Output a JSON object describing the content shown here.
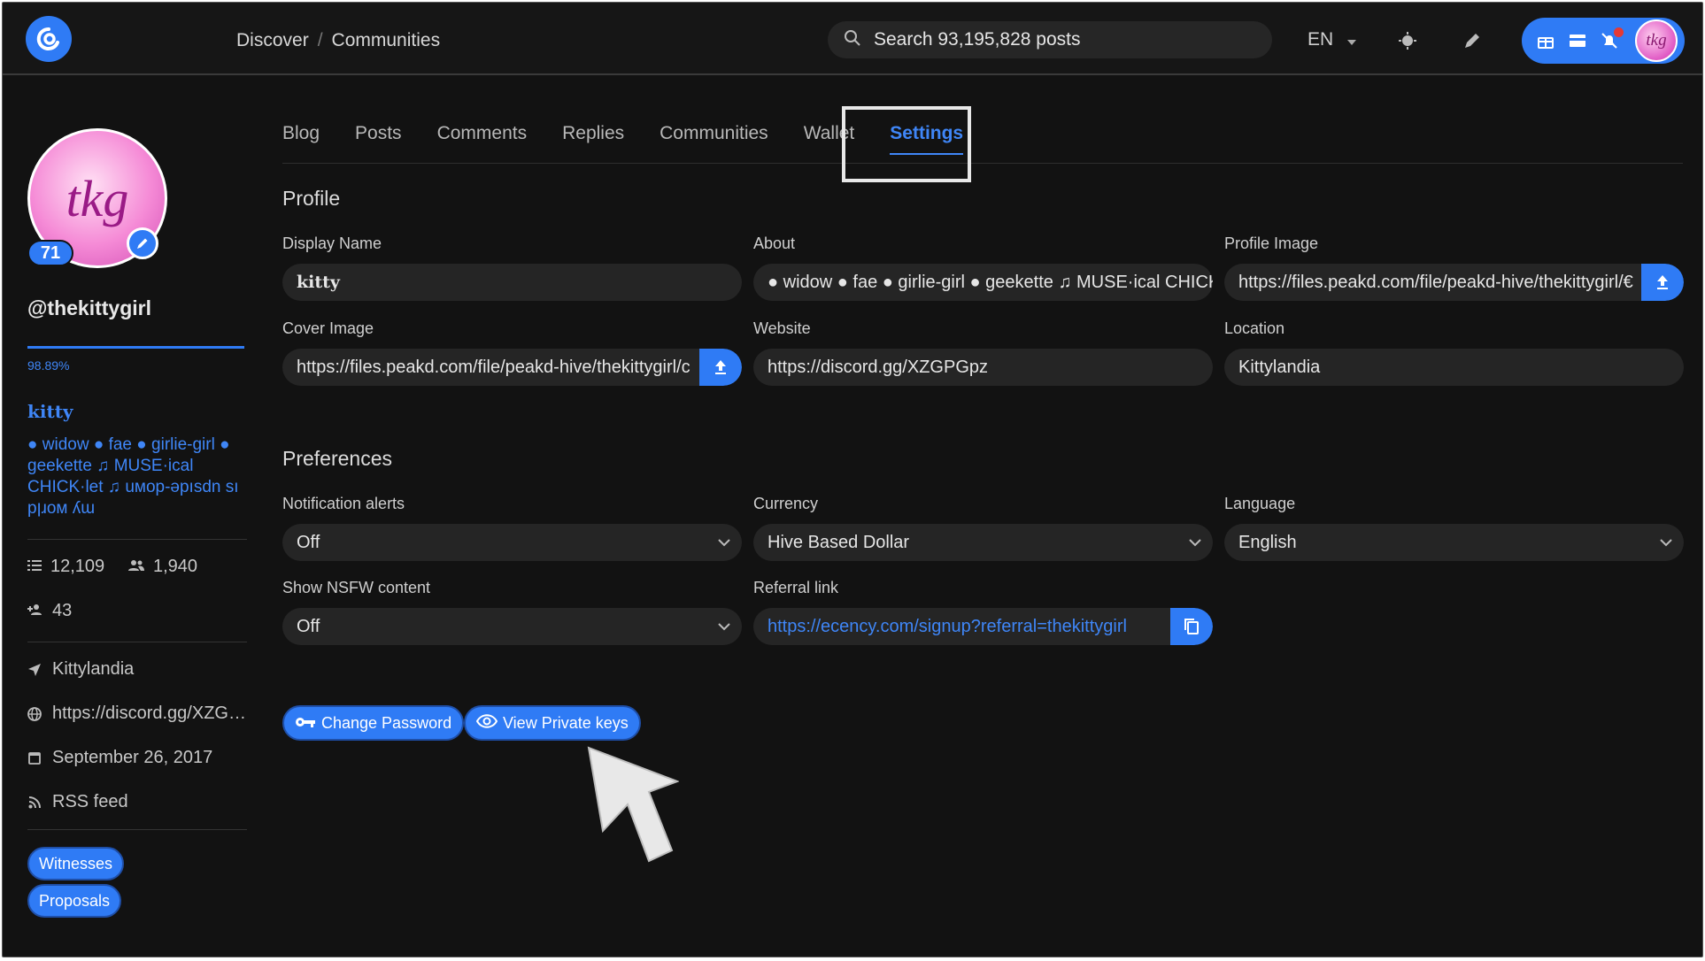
{
  "colors": {
    "accent": "#2f7bf5",
    "background": "#121212",
    "field": "#252525",
    "notification": "#e53935"
  },
  "header": {
    "breadcrumb": [
      "Discover",
      "Communities"
    ],
    "search_placeholder": "Search 93,195,828 posts",
    "language": "EN",
    "icons": [
      "theme-icon",
      "pencil-icon",
      "gift-icon",
      "wallet-icon",
      "bell-off-icon"
    ],
    "avatar_text": "tkg"
  },
  "profile": {
    "avatar_text": "tkg",
    "reputation": "71",
    "username": "@thekittygirl",
    "voting_power": 0.9889,
    "voting_power_text": "98.89%",
    "display_name": "kitty",
    "about": "● widow ● fae ● girlie-girl ● geekette ♫ MUSE·ical CHICK·let ♫ uмop-ǝpısdn sı pןɹoм ʎɯ",
    "posts": "12,109",
    "followers": "1,940",
    "following": "43",
    "location": "Kittylandia",
    "website": "https://discord.gg/XZG…",
    "joined": "September 26, 2017",
    "rss": "RSS feed",
    "buttons": {
      "witnesses": "Witnesses",
      "proposals": "Proposals"
    }
  },
  "tabs": [
    "Blog",
    "Posts",
    "Comments",
    "Replies",
    "Communities",
    "Wallet",
    "Settings"
  ],
  "active_tab": "Settings",
  "settings": {
    "profile_title": "Profile",
    "display_name": {
      "label": "Display Name",
      "value": "kitty"
    },
    "about": {
      "label": "About",
      "value": "● widow ● fae ● girlie-girl ● geekette ♫ MUSE·ical CHICK·let ♫ uмop-ǝpısdn sı pןɹoм ʎɯ"
    },
    "profile_image": {
      "label": "Profile Image",
      "value": "https://files.peakd.com/file/peakd-hive/thekittygirl/€"
    },
    "cover_image": {
      "label": "Cover Image",
      "value": "https://files.peakd.com/file/peakd-hive/thekittygirl/c"
    },
    "website": {
      "label": "Website",
      "value": "https://discord.gg/XZGPGpz"
    },
    "location": {
      "label": "Location",
      "value": "Kittylandia"
    },
    "preferences_title": "Preferences",
    "notification_alerts": {
      "label": "Notification alerts",
      "value": "Off"
    },
    "currency": {
      "label": "Currency",
      "value": "Hive Based Dollar"
    },
    "language": {
      "label": "Language",
      "value": "English"
    },
    "show_nsfw": {
      "label": "Show NSFW content",
      "value": "Off"
    },
    "referral_link": {
      "label": "Referral link",
      "value": "https://ecency.com/signup?referral=thekittygirl"
    },
    "change_password": "Change Password",
    "view_private_keys": "View Private keys"
  }
}
